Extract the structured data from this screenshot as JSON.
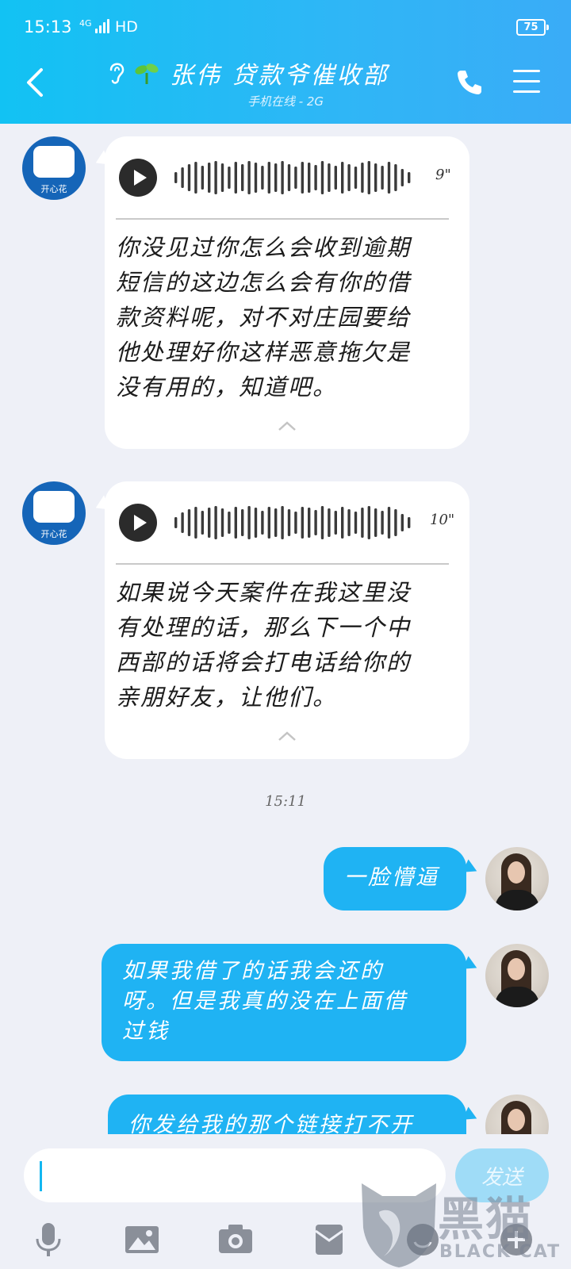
{
  "status_bar": {
    "time": "15:13",
    "network": "4G",
    "hd": "HD",
    "battery": "75"
  },
  "header": {
    "title": "张伟 贷款爷催收部",
    "subtitle": "手机在线 - 2G"
  },
  "messages": [
    {
      "sender": "开心花",
      "duration": "9\"",
      "transcript_lines": [
        "你没见过你怎么会收到逾期",
        "短信的这边怎么会有你的借",
        "款资料呢，对不对庄园要给",
        "他处理好你这样恶意拖欠是",
        "没有用的，知道吧。"
      ]
    },
    {
      "sender": "开心花",
      "duration": "10\"",
      "transcript_lines": [
        "如果说今天案件在我这里没",
        "有处理的话，那么下一个中",
        "西部的话将会打电话给你的",
        "亲朋好友，让他们。"
      ]
    }
  ],
  "timestamp": "15:11",
  "my_messages": [
    {
      "lines": [
        "一脸懵逼"
      ]
    },
    {
      "lines": [
        "如果我借了的话我会还的",
        "呀。但是我真的没在上面借",
        "过钱"
      ]
    },
    {
      "lines": [
        "你发给我的那个链接打不开"
      ]
    }
  ],
  "composer": {
    "placeholder": "",
    "send_label": "发送"
  },
  "watermark": {
    "big": "黑猫",
    "small": "BLACK CAT"
  },
  "colors": {
    "header": "#12c2f3",
    "bubble_blue": "#1fb3f3",
    "background": "#eef0f7"
  }
}
